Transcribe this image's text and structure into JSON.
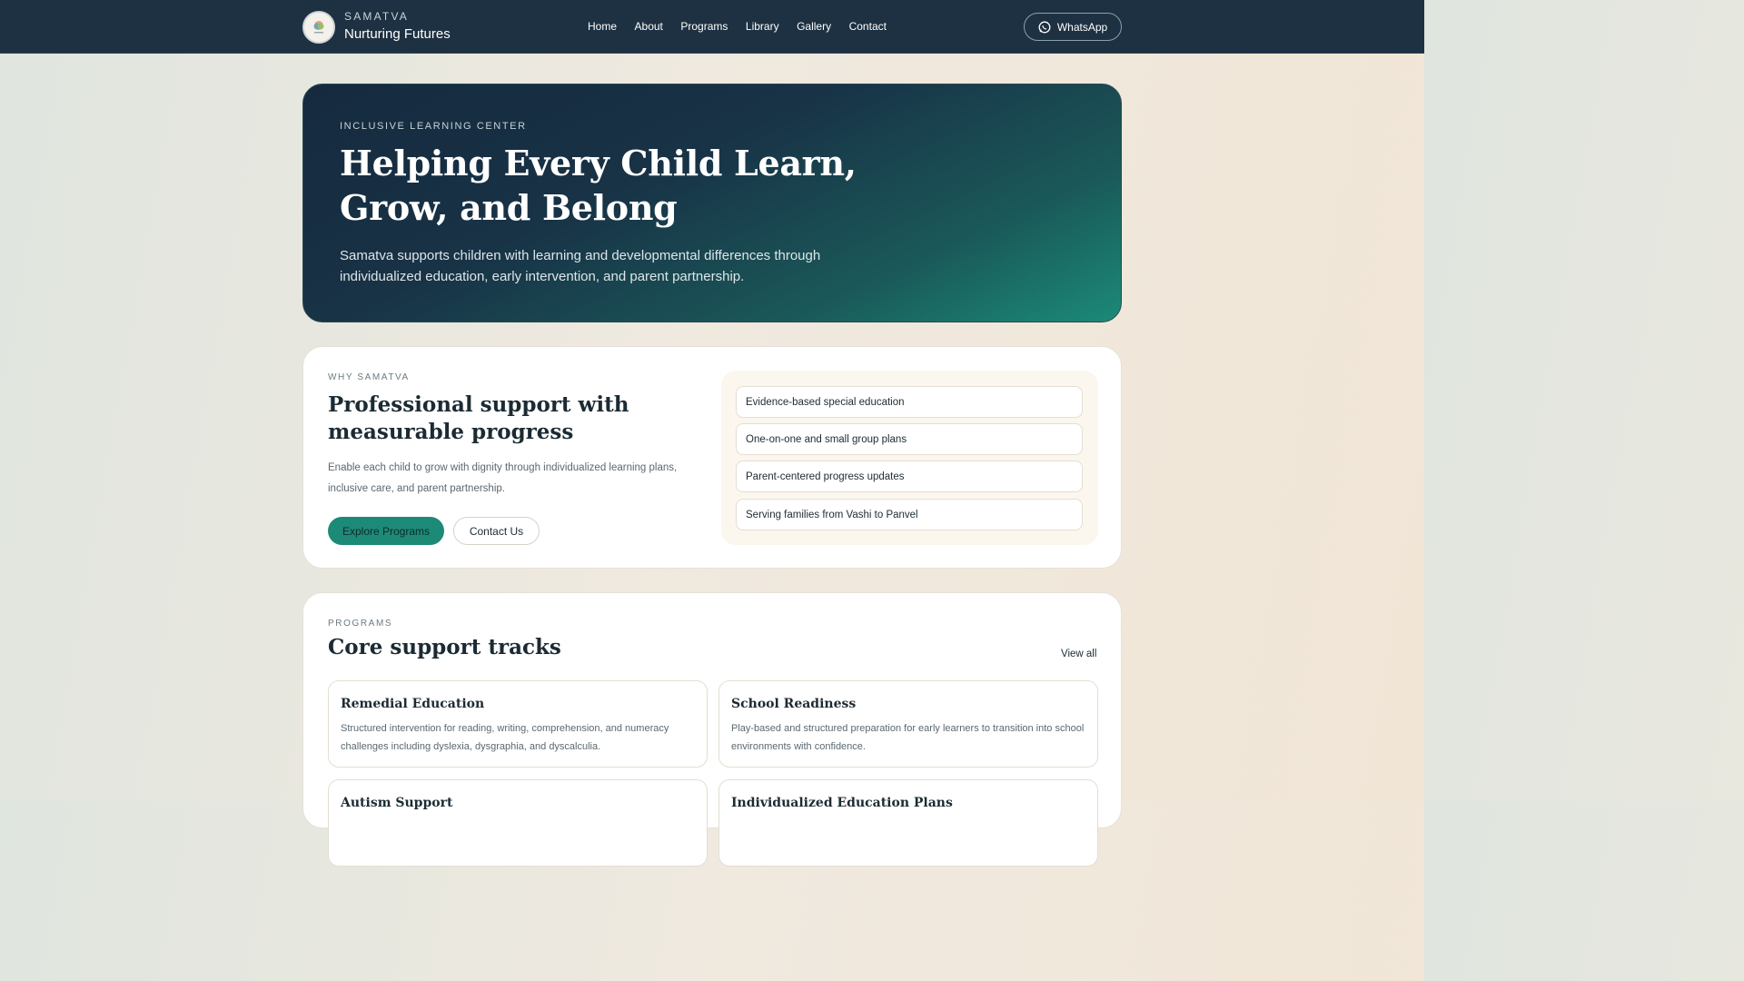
{
  "nav": {
    "brand_small": "SAMATVA",
    "brand_name": "Nurturing Futures",
    "links": [
      "Home",
      "About",
      "Programs",
      "Library",
      "Gallery",
      "Contact"
    ],
    "whatsapp_label": "WhatsApp"
  },
  "hero": {
    "eyebrow": "INCLUSIVE LEARNING CENTER",
    "title": "Helping Every Child Learn, Grow, and Belong",
    "subtitle": "Samatva supports children with learning and developmental differences through individualized education, early intervention, and parent partnership."
  },
  "why": {
    "eyebrow": "WHY SAMATVA",
    "title": "Professional support with measurable progress",
    "body": "Enable each child to grow with dignity through individualized learning plans, inclusive care, and parent partnership.",
    "primary_button": "Explore Programs",
    "secondary_button": "Contact Us",
    "features": [
      "Evidence-based special education",
      "One-on-one and small group plans",
      "Parent-centered progress updates",
      "Serving families from Vashi to Panvel"
    ]
  },
  "programs": {
    "eyebrow": "PROGRAMS",
    "title": "Core support tracks",
    "view_all": "View all",
    "items": [
      {
        "title": "Remedial Education",
        "description": "Structured intervention for reading, writing, comprehension, and numeracy challenges including dyslexia, dysgraphia, and dyscalculia."
      },
      {
        "title": "School Readiness",
        "description": "Play-based and structured preparation for early learners to transition into school environments with confidence."
      },
      {
        "title": "Autism Support",
        "description": ""
      },
      {
        "title": "Individualized Education Plans",
        "description": ""
      }
    ]
  },
  "colors": {
    "nav_bg": "#1e3142",
    "accent": "#1d8a78",
    "hero_start": "#162a3e",
    "hero_end": "#1b8a78"
  }
}
